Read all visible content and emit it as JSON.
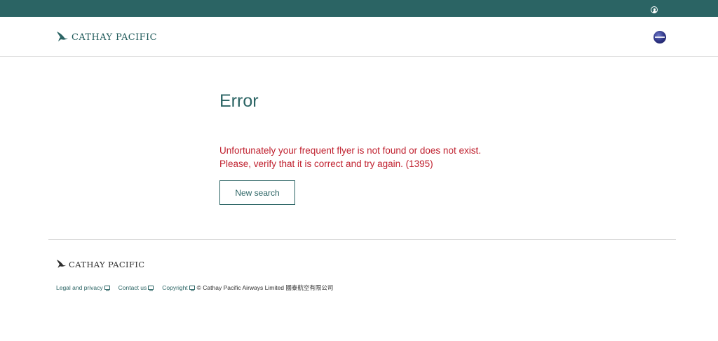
{
  "header": {
    "logo_text": "CATHAY PACIFIC",
    "profile_icon": "user-profile-icon",
    "alliance_icon": "oneworld-icon"
  },
  "main": {
    "title": "Error",
    "message": "Unfortunately your frequent flyer is not found or does not exist. Please, verify that it is correct and try again. (1395)",
    "new_search_label": "New search"
  },
  "footer": {
    "logo_text": "CATHAY PACIFIC",
    "links": [
      {
        "label": "Legal and privacy",
        "icon": "external-link-icon"
      },
      {
        "label": "Contact us",
        "icon": "external-link-icon"
      },
      {
        "label": "Copyright",
        "icon": "external-link-icon"
      }
    ],
    "copyright": "© Cathay Pacific Airways Limited 國泰航空有限公司"
  },
  "colors": {
    "brand_teal": "#2b6464",
    "error_red": "#c0212f",
    "topbar": "#2b6464"
  }
}
